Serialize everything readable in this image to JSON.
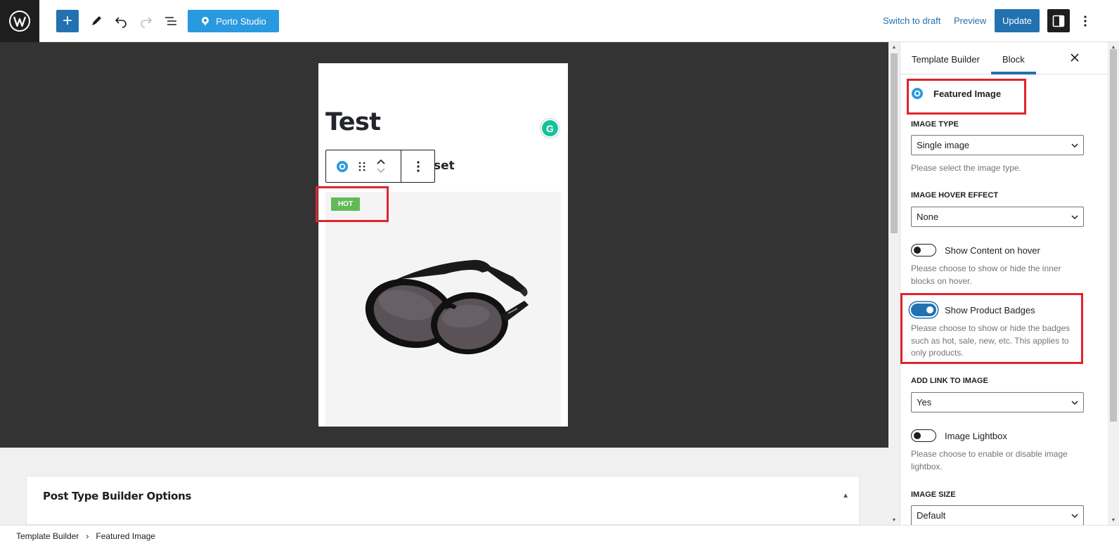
{
  "header": {
    "porto_studio_label": "Porto Studio",
    "switch_to_draft": "Switch to draft",
    "preview": "Preview",
    "update": "Update"
  },
  "canvas": {
    "post_title": "Test",
    "sub_title_fragment": "set",
    "badge_label": "HOT",
    "grammarly_letter": "G"
  },
  "lower_panel": {
    "metabox_title": "Post Type Builder Options"
  },
  "breadcrumb": {
    "items": [
      "Template Builder",
      "Featured Image"
    ]
  },
  "sidebar": {
    "tabs": [
      "Template Builder",
      "Block"
    ],
    "active_tab": "Block",
    "block_name": "Featured Image",
    "image_type": {
      "label": "IMAGE TYPE",
      "value": "Single image",
      "help": "Please select the image type."
    },
    "image_hover_effect": {
      "label": "IMAGE HOVER EFFECT",
      "value": "None"
    },
    "show_content_on_hover": {
      "label": "Show Content on hover",
      "checked": false,
      "help": "Please choose to show or hide the inner blocks on hover."
    },
    "show_product_badges": {
      "label": "Show Product Badges",
      "checked": true,
      "help": "Please choose to show or hide the badges such as hot, sale, new, etc. This applies to only products."
    },
    "add_link_to_image": {
      "label": "ADD LINK TO IMAGE",
      "value": "Yes"
    },
    "image_lightbox": {
      "label": "Image Lightbox",
      "checked": false,
      "help": "Please choose to enable or disable image lightbox."
    },
    "image_size": {
      "label": "IMAGE SIZE",
      "value": "Default"
    }
  },
  "colors": {
    "accent": "#2271b1",
    "highlight": "#e0242b",
    "badge_hot": "#62b959",
    "canvas_bg": "#333333"
  }
}
